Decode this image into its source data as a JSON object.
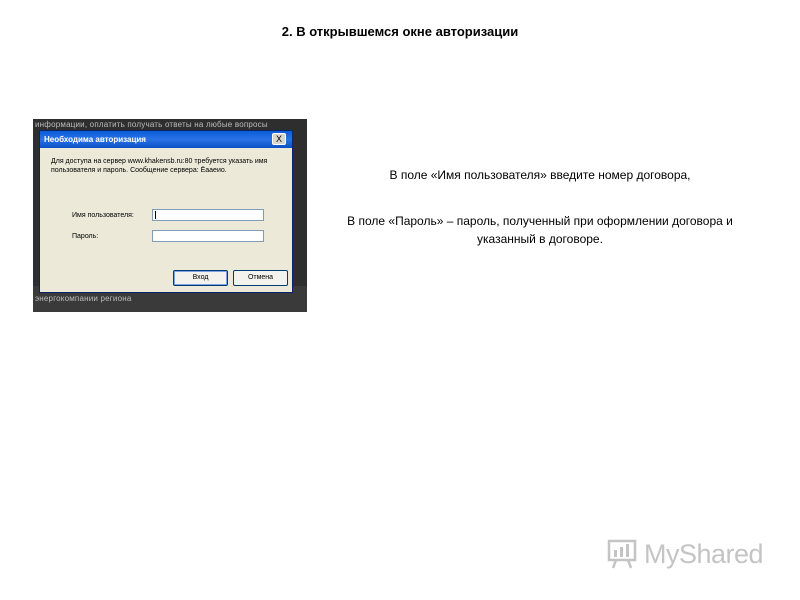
{
  "slide": {
    "title": "2. В открывшемся окне авторизации",
    "instruction_1": "В поле «Имя пользователя» введите номер договора,",
    "instruction_2": "В поле «Пароль» – пароль, полученный при оформлении договора и указанный в договоре."
  },
  "screenshot": {
    "background_text_top": "информации, оплатить получать ответы на любые вопросы",
    "background_text_bottom": "энергокомпании региона",
    "dialog": {
      "title": "Необходима авторизация",
      "close_glyph": "X",
      "message": "Для доступа на сервер www.khakensb.ru:80 требуется указать имя пользователя и пароль. Сообщение сервера: Ёааеио.",
      "username_label": "Имя пользователя:",
      "password_label": "Пароль:",
      "username_value": "",
      "password_value": "",
      "ok_button": "Вход",
      "cancel_button": "Отмена"
    }
  },
  "watermark": {
    "text": "MyShared",
    "icon": "chart-board-icon"
  },
  "colors": {
    "titlebar": "#0a5cd8",
    "dialog_bg": "#ece9d8",
    "watermark": "#c4c4c4"
  }
}
